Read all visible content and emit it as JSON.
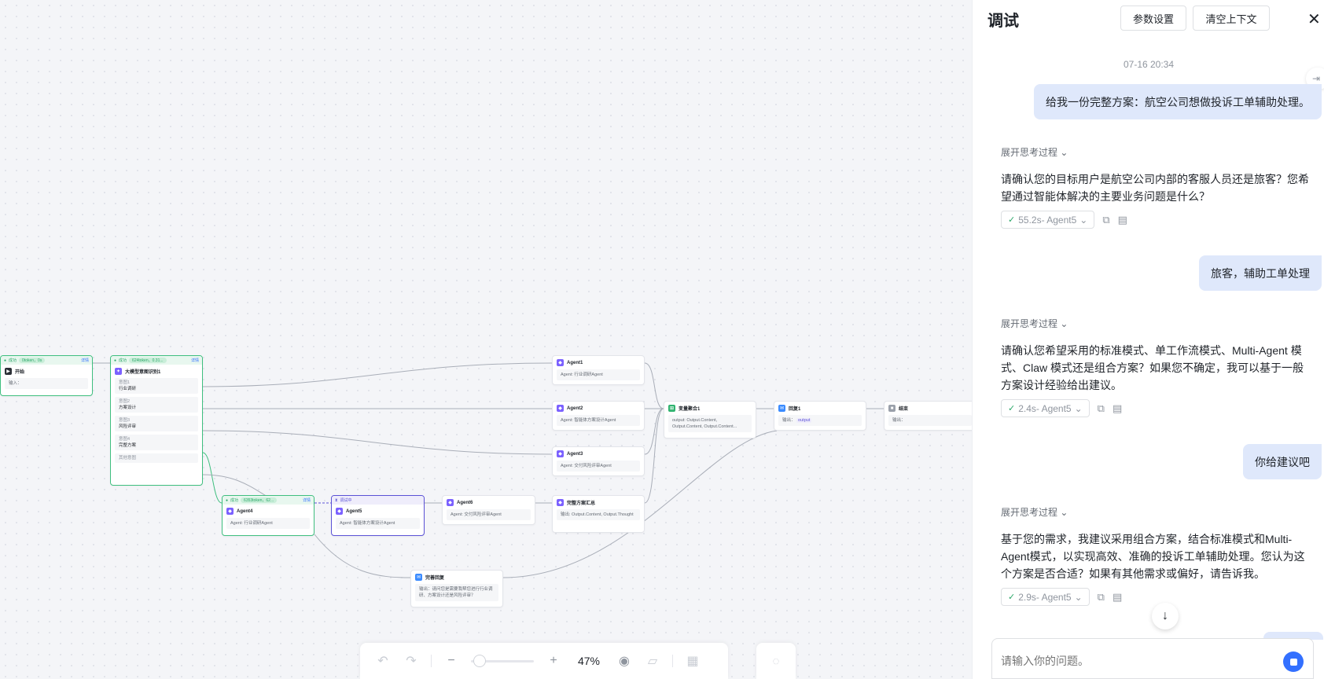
{
  "canvas": {
    "nodes": {
      "start": {
        "status": "成功",
        "pill": "0token，0s",
        "detail": "详情",
        "title": "开始",
        "field": "输入："
      },
      "intent": {
        "status": "成功",
        "pill": "624token，0.31...",
        "detail": "详情",
        "title": "大模型意图识别1",
        "items": [
          {
            "k": "意图1",
            "v": "行业调研"
          },
          {
            "k": "意图2",
            "v": "方案设计"
          },
          {
            "k": "意图3",
            "v": "风险评审"
          },
          {
            "k": "意图4",
            "v": "完整方案"
          }
        ],
        "other": "其他意图"
      },
      "agent1": {
        "title": "Agent1",
        "field": "Agent: 行业调研Agent"
      },
      "agent2": {
        "title": "Agent2",
        "field": "Agent: 智能体方案设计Agent"
      },
      "agent3": {
        "title": "Agent3",
        "field": "Agent: 交付风险评审Agent"
      },
      "aggregate": {
        "title": "变量聚合1",
        "field": "output:  Output.Content,  Output.Content,  Output.Content..."
      },
      "reply1": {
        "title": "回复1",
        "field_label": "输出：",
        "field_tag": "output"
      },
      "end": {
        "title": "结束",
        "field": "输出："
      },
      "agent4": {
        "status": "成功",
        "pill": "6353token，62...",
        "detail": "详情",
        "title": "Agent4",
        "field": "Agent: 行业调研Agent"
      },
      "agent5": {
        "status": "调试中",
        "title": "Agent5",
        "field": "Agent: 智能体方案设计Agent"
      },
      "agent6": {
        "title": "Agent6",
        "field": "Agent: 交付风险评审Agent"
      },
      "summary": {
        "title": "完整方案汇总",
        "field": "输出:   Output.Content,  Output.Thought"
      },
      "guide": {
        "title": "完善回复",
        "field": "输出：请问您是需要我帮您进行行业调研、方案设计还是风险评审？"
      }
    }
  },
  "toolbar": {
    "undo_icon": "↶",
    "redo_icon": "↷",
    "zoom_out_icon": "−",
    "zoom_in_icon": "+",
    "zoom_level": "47%",
    "zoom_fraction": 0.05,
    "preview_icon": "◉",
    "note_icon": "▱",
    "grid_icon": "▦",
    "tip_icon": "◌"
  },
  "panel": {
    "title": "调试",
    "param_button": "参数设置",
    "clear_button": "清空上下文",
    "close_icon": "✕",
    "timestamp": "07-16 20:34",
    "messages": [
      {
        "role": "user",
        "text": "给我一份完整方案：航空公司想做投诉工单辅助处理。"
      },
      {
        "role": "assistant",
        "expand": "展开思考过程 ⌄",
        "text": "请确认您的目标用户是航空公司内部的客服人员还是旅客？您希望通过智能体解决的主要业务问题是什么？",
        "meta": "55.2s- Agent5"
      },
      {
        "role": "user",
        "text": "旅客，辅助工单处理"
      },
      {
        "role": "assistant",
        "expand": "展开思考过程 ⌄",
        "text": "请确认您希望采用的标准模式、单工作流模式、Multi-Agent 模式、Claw 模式还是组合方案？如果您不确定，我可以基于一般方案设计经验给出建议。",
        "meta": "2.4s- Agent5"
      },
      {
        "role": "user",
        "text": "你给建议吧"
      },
      {
        "role": "assistant",
        "expand": "展开思考过程 ⌄",
        "text": "基于您的需求，我建议采用组合方案，结合标准模式和Multi-Agent模式，以实现高效、准确的投诉工单辅助处理。您认为这个方案是否合适？如果有其他需求或偏好，请告诉我。",
        "meta": "2.9s- Agent5"
      }
    ],
    "check_icon": "✓",
    "chevron_icon": "⌄",
    "copy_icon": "⧉",
    "note_icon": "▤",
    "scroll_icon": "↓",
    "input_placeholder": "请输入你的问题。",
    "side_icon": "⇥"
  }
}
